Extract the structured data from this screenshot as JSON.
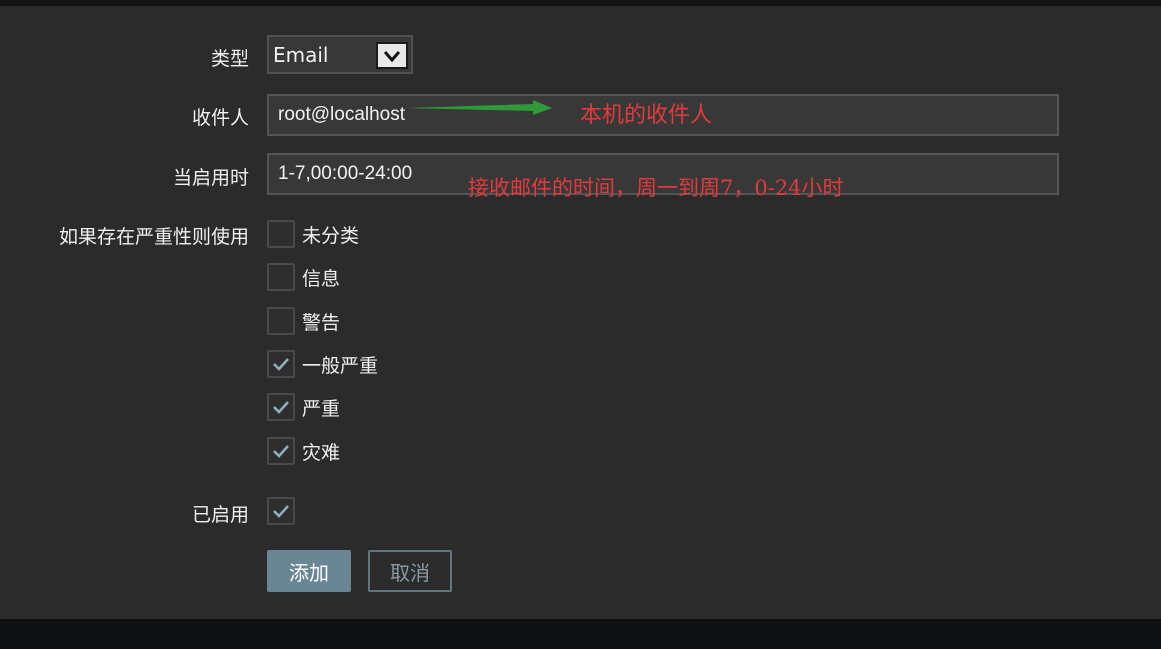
{
  "form": {
    "type_label": "类型",
    "type_value": "Email",
    "recipient_label": "收件人",
    "recipient_value": "root@localhost",
    "when_active_label": "当启用时",
    "when_active_value": "1-7,00:00-24:00",
    "severity_label": "如果存在严重性则使用",
    "severities": [
      {
        "label": "未分类",
        "checked": false
      },
      {
        "label": "信息",
        "checked": false
      },
      {
        "label": "警告",
        "checked": false
      },
      {
        "label": "一般严重",
        "checked": true
      },
      {
        "label": "严重",
        "checked": true
      },
      {
        "label": "灾难",
        "checked": true
      }
    ],
    "enabled_label": "已启用",
    "enabled_checked": true,
    "add_label": "添加",
    "cancel_label": "取消"
  },
  "annotations": {
    "recipient_note": "本机的收件人",
    "time_note": "接收邮件的时间，周一到周7，0-24小时"
  },
  "colors": {
    "panel_bg": "#2b2b2b",
    "annotation_red": "#e23b3b",
    "arrow_green": "#2f9a3a",
    "add_button": "#6a8593",
    "check_mark": "#8fb0c2"
  }
}
